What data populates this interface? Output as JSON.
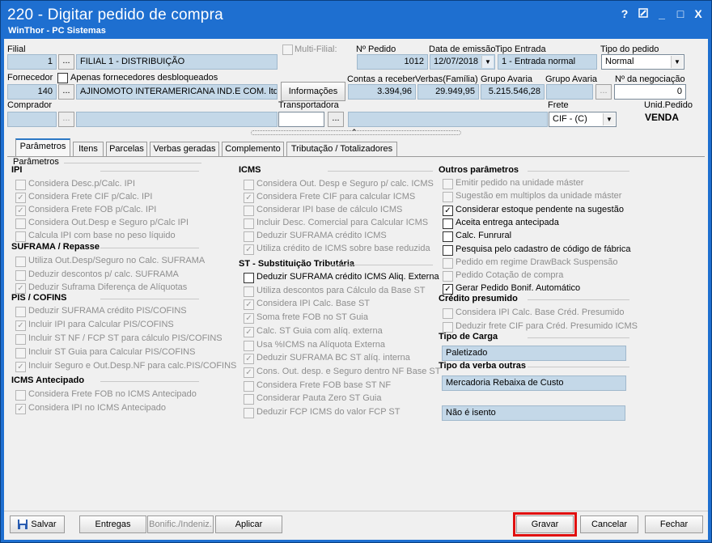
{
  "window": {
    "title": "220 - Digitar pedido de compra",
    "subtitle": "WinThor - PC Sistemas",
    "controls": [
      "?",
      "edit",
      "_",
      "□",
      "X"
    ]
  },
  "header": {
    "filial_label": "Filial",
    "filial_code": "1",
    "filial_name": "FILIAL 1 - DISTRIBUIÇÃO",
    "multi_filial_label": "Multi-Filial:",
    "num_pedido_label": "Nº Pedido",
    "num_pedido": "1012",
    "data_emissao_label": "Data de emissão",
    "data_emissao": "12/07/2018",
    "tipo_entrada_label": "Tipo Entrada",
    "tipo_entrada": "1 - Entrada normal",
    "tipo_pedido_label": "Tipo do pedido",
    "tipo_pedido": "Normal",
    "fornecedor_label": "Fornecedor",
    "apenas_desbloq_label": "Apenas fornecedores desbloqueados",
    "fornecedor_code": "140",
    "fornecedor_name": "AJINOMOTO INTERAMERICANA IND.E COM. ltda",
    "informacoes_label": "Informações",
    "contas_receber_label": "Contas a receber",
    "contas_receber": "3.394,96",
    "verbas_label": "Verbas(Família)",
    "verbas": "29.949,95",
    "grupo_avaria_label": "Grupo Avaria",
    "grupo_avaria": "5.215.546,28",
    "grupo_avaria2_label": "Grupo Avaria",
    "grupo_avaria2": "",
    "negociacao_label": "Nº da negociação",
    "negociacao": "0",
    "comprador_label": "Comprador",
    "transportadora_label": "Transportadora",
    "frete_label": "Frete",
    "frete": "CIF - (C)",
    "unid_pedido_label": "Unid.Pedido",
    "unid_pedido": "VENDA",
    "ellipsis": "..."
  },
  "tabs": [
    "Parâmetros",
    "Itens",
    "Parcelas",
    "Verbas geradas",
    "Complemento",
    "Tributação / Totalizadores"
  ],
  "panel_title": "Parâmetros",
  "col1": {
    "ipi_title": "IPI",
    "ipi": [
      {
        "label": "Considera Desc.p/Calc. IPI",
        "checked": false
      },
      {
        "label": "Considera Frete CIF p/Calc. IPI",
        "checked": true
      },
      {
        "label": "Considera Frete FOB p/Calc. IPI",
        "checked": true
      },
      {
        "label": "Considera Out.Desp e Seguro p/Calc IPI",
        "checked": false
      },
      {
        "label": "Calcula IPI com base no peso líquido",
        "checked": false
      }
    ],
    "suframa_title": "SUFRAMA / Repasse",
    "suframa": [
      {
        "label": "Utiliza Out.Desp/Seguro no Calc. SUFRAMA",
        "checked": false
      },
      {
        "label": "Deduzir descontos p/ calc. SUFRAMA",
        "checked": false
      },
      {
        "label": "Deduzir Suframa Diferença de Alíquotas",
        "checked": true
      }
    ],
    "pis_title": "PIS / COFINS",
    "pis": [
      {
        "label": "Deduzir SUFRAMA crédito PIS/COFINS",
        "checked": false
      },
      {
        "label": "Incluir IPI para Calcular PIS/COFINS",
        "checked": true
      },
      {
        "label": "Incluir ST NF / FCP ST para cálculo PIS/COFINS",
        "checked": false
      },
      {
        "label": "Incluir ST Guia para Calcular PIS/COFINS",
        "checked": false
      },
      {
        "label": "Incluir Seguro e Out.Desp.NF para calc.PIS/COFINS",
        "checked": true
      }
    ],
    "icmsant_title": "ICMS Antecipado",
    "icmsant": [
      {
        "label": "Considera Frete FOB no ICMS Antecipado",
        "checked": false
      },
      {
        "label": "Considera IPI no ICMS Antecipado",
        "checked": true
      }
    ]
  },
  "col2": {
    "icms_title": "ICMS",
    "icms": [
      {
        "label": "Considera Out. Desp e Seguro p/ calc. ICMS",
        "checked": false
      },
      {
        "label": "Considera Frete CIF para calcular ICMS",
        "checked": true
      },
      {
        "label": "Considerar IPI base de cálculo ICMS",
        "checked": false
      },
      {
        "label": "Incluir Desc. Comercial  para Calcular ICMS",
        "checked": false
      },
      {
        "label": "Deduzir SUFRAMA crédito ICMS",
        "checked": false
      },
      {
        "label": "Utiliza crédito de ICMS sobre base reduzida",
        "checked": true
      }
    ],
    "st_title": "ST - Substituição Tributária",
    "st": [
      {
        "label": "Deduzir SUFRAMA crédito ICMS Aliq. Externa",
        "checked": false,
        "enabled": true
      },
      {
        "label": "Utiliza descontos para Cálculo da Base ST",
        "checked": false,
        "enabled": false
      },
      {
        "label": "Considera IPI Calc. Base ST",
        "checked": true,
        "enabled": false
      },
      {
        "label": "Soma frete FOB no ST Guia",
        "checked": true,
        "enabled": false
      },
      {
        "label": "Calc. ST Guia com alíq. externa",
        "checked": true,
        "enabled": false
      },
      {
        "label": "Usa %ICMS na Alíquota Externa",
        "checked": false,
        "enabled": false
      },
      {
        "label": "Deduzir SUFRAMA BC ST alíq. interna",
        "checked": true,
        "enabled": false
      },
      {
        "label": "Cons. Out. desp. e Seguro dentro NF Base ST",
        "checked": true,
        "enabled": false
      },
      {
        "label": "Considera Frete FOB base ST NF",
        "checked": false,
        "enabled": false
      },
      {
        "label": "Considerar Pauta Zero ST Guia",
        "checked": false,
        "enabled": false
      },
      {
        "label": "Deduzir FCP ICMS do valor FCP ST",
        "checked": false,
        "enabled": false
      }
    ]
  },
  "col3": {
    "outros_title": "Outros parâmetros",
    "outros": [
      {
        "label": "Emitir pedido na unidade máster",
        "checked": false,
        "enabled": false
      },
      {
        "label": "Sugestão em multiplos da unidade máster",
        "checked": false,
        "enabled": false
      },
      {
        "label": "Considerar estoque pendente na sugestão",
        "checked": true,
        "enabled": true
      },
      {
        "label": "Aceita entrega antecipada",
        "checked": false,
        "enabled": true
      },
      {
        "label": "Calc. Funrural",
        "checked": false,
        "enabled": true
      },
      {
        "label": "Pesquisa pelo cadastro de código de fábrica",
        "checked": false,
        "enabled": true
      },
      {
        "label": "Pedido em regime DrawBack Suspensão",
        "checked": false,
        "enabled": false
      },
      {
        "label": "Pedido Cotação de compra",
        "checked": false,
        "enabled": false
      },
      {
        "label": "Gerar Pedido Bonif. Automático",
        "checked": true,
        "enabled": true
      }
    ],
    "credito_title": "Crédito presumido",
    "credito": [
      {
        "label": "Considera IPI Calc. Base Créd. Presumido",
        "checked": false
      },
      {
        "label": "Deduzir frete CIF para Créd. Presumido ICMS",
        "checked": false
      }
    ],
    "carga_title": "Tipo de Carga",
    "carga": "Paletizado",
    "verba_title": "Tipo da verba outras",
    "verba": "Mercadoria Rebaixa de Custo",
    "isento": "Não é isento"
  },
  "footer": {
    "salvar": "Salvar",
    "entregas": "Entregas",
    "bonif": "Bonific./Indeniz.",
    "aplicar": "Aplicar",
    "gravar": "Gravar",
    "cancelar": "Cancelar",
    "fechar": "Fechar"
  },
  "colors": {
    "title_bar": "#1e6fd0",
    "highlight": "#e01010",
    "field_readonly": "#c4d8e8"
  }
}
